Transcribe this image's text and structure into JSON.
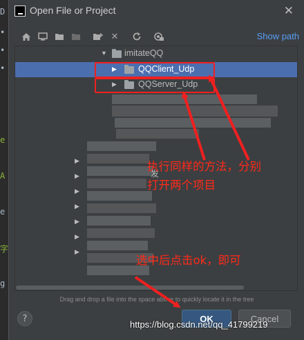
{
  "background": {
    "strip_chars": [
      "D",
      "•",
      "•",
      "•",
      "e",
      "A",
      "e",
      "字",
      "g"
    ]
  },
  "dialog": {
    "title": "Open File or Project",
    "show_path": "Show path",
    "hint": "Drag and drop a file into the space above to quickly locate it in the tree",
    "tree": {
      "root": "imitateQQ",
      "items": [
        "QQClient_Udp",
        "QQServer_Udp"
      ],
      "partial_label": "发"
    },
    "buttons": {
      "help": "?",
      "ok": "OK",
      "cancel": "Cancel"
    }
  },
  "annotations": {
    "note1_line1": "执行同样的方法，分别",
    "note1_line2": "打开两个项目",
    "note2": "选中后点击ok，即可",
    "color": "#ff2a1a"
  },
  "watermark": "https://blog.csdn.net/qq_41799219",
  "colors": {
    "selection": "#4b6eaf",
    "ok_button": "#365880",
    "link": "#589df6",
    "annotation_red": "#f02020"
  }
}
